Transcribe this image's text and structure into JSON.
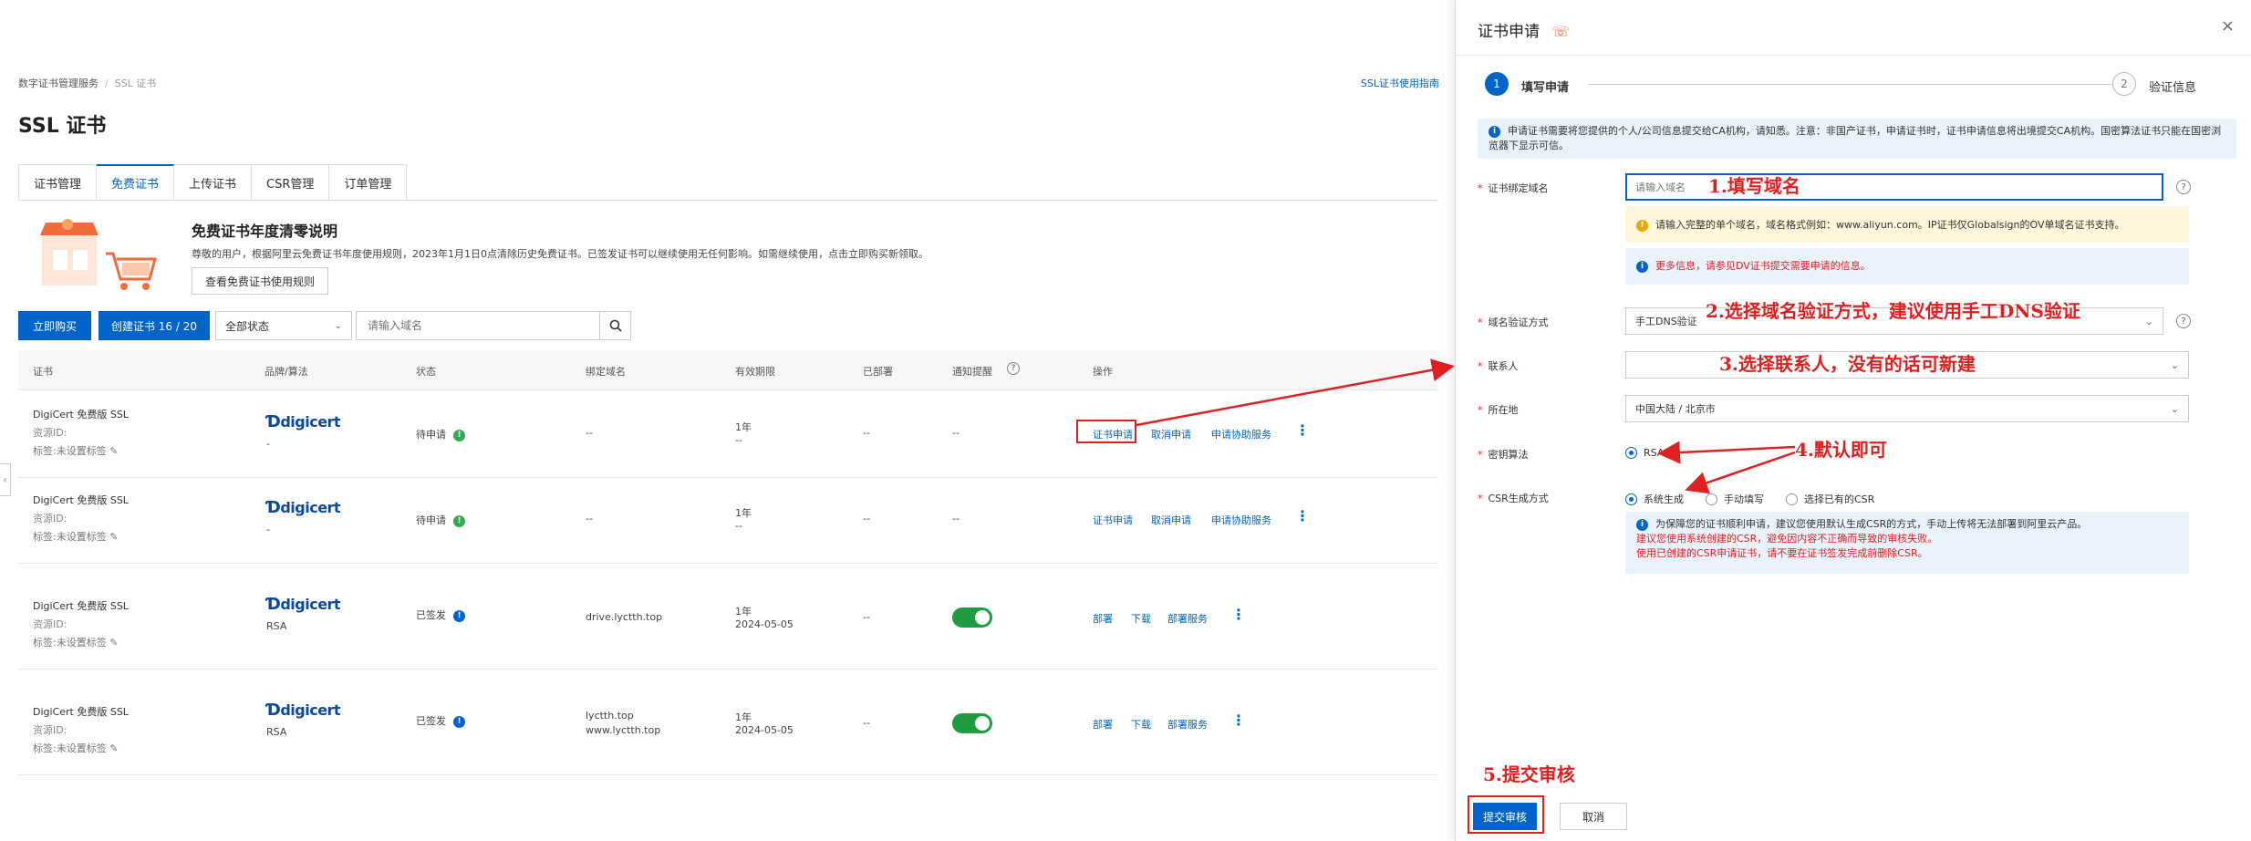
{
  "breadcrumb": {
    "parent": "数字证书管理服务",
    "separator": "/",
    "current": "SSL 证书"
  },
  "guide_link": "SSL证书使用指南",
  "page_title": "SSL 证书",
  "tabs": [
    {
      "label": "证书管理",
      "active": false
    },
    {
      "label": "免费证书",
      "active": true
    },
    {
      "label": "上传证书",
      "active": false
    },
    {
      "label": "CSR管理",
      "active": false
    },
    {
      "label": "订单管理",
      "active": false
    }
  ],
  "notice": {
    "title": "免费证书年度清零说明",
    "text": "尊敬的用户，根据阿里云免费证书年度使用规则，2023年1月1日0点清除历史免费证书。已签发证书可以继续使用无任何影响。如需继续使用，点击立即购买新领取。",
    "button": "查看免费证书使用规则"
  },
  "toolbar": {
    "buy": "立即购买",
    "create": "创建证书 16 / 20",
    "status_select": "全部状态",
    "search_placeholder": "请输入域名"
  },
  "table": {
    "headers": [
      "证书",
      "品牌/算法",
      "状态",
      "绑定域名",
      "有效期限",
      "已部署",
      "通知提醒",
      "操作"
    ],
    "rows": [
      {
        "name": "DigiCert 免费版 SSL",
        "id": "资源ID:",
        "tag": "标签:未设置标签",
        "brand": "digicert",
        "algo": "-",
        "status": "待申请",
        "status_icon": "!",
        "domain": "--",
        "validity": "1年",
        "validity2": "--",
        "deployed": "--",
        "notify": "--",
        "notify_toggle": false,
        "actions": [
          "证书申请",
          "取消申请",
          "申请协助服务"
        ]
      },
      {
        "name": "DigiCert 免费版 SSL",
        "id": "资源ID:",
        "tag": "标签:未设置标签",
        "brand": "digicert",
        "algo": "-",
        "status": "待申请",
        "status_icon": "!",
        "domain": "--",
        "validity": "1年",
        "validity2": "--",
        "deployed": "--",
        "notify": "--",
        "notify_toggle": false,
        "actions": [
          "证书申请",
          "取消申请",
          "申请协助服务"
        ]
      },
      {
        "name": "DigiCert 免费版 SSL",
        "id": "资源ID:",
        "tag": "标签:未设置标签",
        "brand": "digicert",
        "algo": "RSA",
        "status": "已签发",
        "status_icon": "!",
        "domain": "drive.lyctth.top",
        "domain2": "",
        "validity": "1年",
        "validity2": "2024-05-05",
        "deployed": "--",
        "notify": "",
        "notify_toggle": true,
        "actions": [
          "部署",
          "下载",
          "部署服务"
        ]
      },
      {
        "name": "DigiCert 免费版 SSL",
        "id": "资源ID:",
        "tag": "标签:未设置标签",
        "brand": "digicert",
        "algo": "RSA",
        "status": "已签发",
        "status_icon": "!",
        "domain": "lyctth.top",
        "domain2": "www.lyctth.top",
        "validity": "1年",
        "validity2": "2024-05-05",
        "deployed": "--",
        "notify": "",
        "notify_toggle": true,
        "actions": [
          "部署",
          "下载",
          "部署服务"
        ]
      }
    ]
  },
  "drawer": {
    "title": "证书申请",
    "steps": [
      {
        "num": "1",
        "label": "填写申请",
        "active": true
      },
      {
        "num": "2",
        "label": "验证信息",
        "active": false
      }
    ],
    "info": "申请证书需要将您提供的个人/公司信息提交给CA机构，请知悉。注意：非国产证书，申请证书时，证书申请信息将出境提交CA机构。国密算法证书只能在国密浏览器下显示可信。",
    "fields": {
      "domain_label": "证书绑定域名",
      "domain_placeholder": "请输入域名",
      "domain_tip": "请输入完整的单个域名，域名格式例如：www.aliyun.com。IP证书仅Globalsign的OV单域名证书支持。",
      "domain_more_prefix": "更多信息，",
      "domain_more_link": "请参见DV证书提交需要申请的信息。",
      "verify_label": "域名验证方式",
      "verify_value": "手工DNS验证",
      "contact_label": "联系人",
      "contact_value": "",
      "location_label": "所在地",
      "location_value": "中国大陆 / 北京市",
      "algo_label": "密钥算法",
      "algo_value": "RSA",
      "csr_label": "CSR生成方式",
      "csr_options": [
        "系统生成",
        "手动填写",
        "选择已有的CSR"
      ],
      "csr_info": "为保障您的证书顺利申请，建议您使用默认生成CSR的方式，手动上传将无法部署到阿里云产品。",
      "csr_warn1": "建议您使用系统创建的CSR，避免因内容不正确而导致的审核失败。",
      "csr_warn2": "使用已创建的CSR申请证书，请不要在证书签发完成前删除CSR。"
    },
    "submit": "提交审核",
    "cancel": "取消",
    "close": "×"
  },
  "annotations": {
    "a1": "1.填写域名",
    "a2": "2.选择域名验证方式，建议使用手工DNS验证",
    "a3": "3.选择联系人，没有的话可新建",
    "a4": "4.默认即可",
    "a5": "5.提交审核"
  },
  "colors": {
    "primary": "#0064c8",
    "annotation": "#e02020",
    "success": "#35a853",
    "toggle": "#1f9c3f"
  }
}
